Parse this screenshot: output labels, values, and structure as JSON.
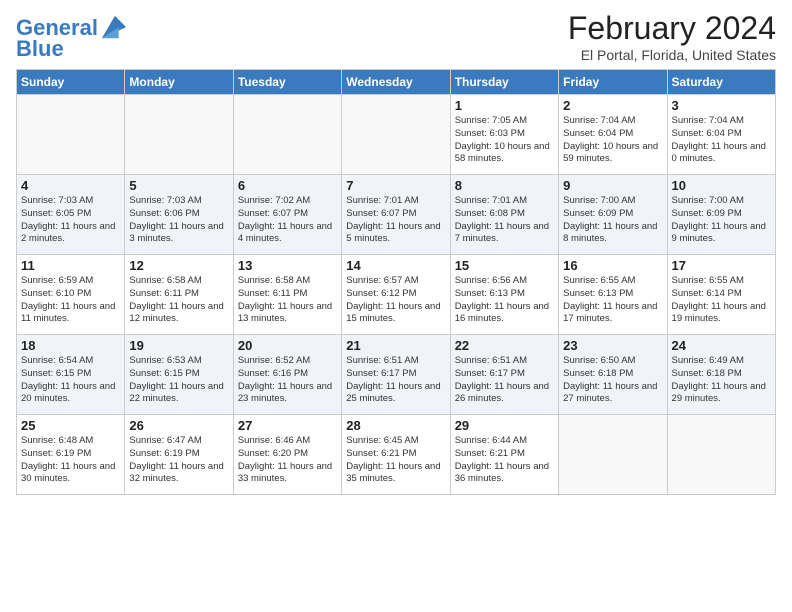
{
  "header": {
    "logo_general": "General",
    "logo_blue": "Blue",
    "title": "February 2024",
    "location": "El Portal, Florida, United States"
  },
  "weekdays": [
    "Sunday",
    "Monday",
    "Tuesday",
    "Wednesday",
    "Thursday",
    "Friday",
    "Saturday"
  ],
  "weeks": [
    [
      {
        "day": "",
        "empty": true
      },
      {
        "day": "",
        "empty": true
      },
      {
        "day": "",
        "empty": true
      },
      {
        "day": "",
        "empty": true
      },
      {
        "day": "1",
        "sunrise": "7:05 AM",
        "sunset": "6:03 PM",
        "daylight": "10 hours and 58 minutes."
      },
      {
        "day": "2",
        "sunrise": "7:04 AM",
        "sunset": "6:04 PM",
        "daylight": "10 hours and 59 minutes."
      },
      {
        "day": "3",
        "sunrise": "7:04 AM",
        "sunset": "6:04 PM",
        "daylight": "11 hours and 0 minutes."
      }
    ],
    [
      {
        "day": "4",
        "sunrise": "7:03 AM",
        "sunset": "6:05 PM",
        "daylight": "11 hours and 2 minutes."
      },
      {
        "day": "5",
        "sunrise": "7:03 AM",
        "sunset": "6:06 PM",
        "daylight": "11 hours and 3 minutes."
      },
      {
        "day": "6",
        "sunrise": "7:02 AM",
        "sunset": "6:07 PM",
        "daylight": "11 hours and 4 minutes."
      },
      {
        "day": "7",
        "sunrise": "7:01 AM",
        "sunset": "6:07 PM",
        "daylight": "11 hours and 5 minutes."
      },
      {
        "day": "8",
        "sunrise": "7:01 AM",
        "sunset": "6:08 PM",
        "daylight": "11 hours and 7 minutes."
      },
      {
        "day": "9",
        "sunrise": "7:00 AM",
        "sunset": "6:09 PM",
        "daylight": "11 hours and 8 minutes."
      },
      {
        "day": "10",
        "sunrise": "7:00 AM",
        "sunset": "6:09 PM",
        "daylight": "11 hours and 9 minutes."
      }
    ],
    [
      {
        "day": "11",
        "sunrise": "6:59 AM",
        "sunset": "6:10 PM",
        "daylight": "11 hours and 11 minutes."
      },
      {
        "day": "12",
        "sunrise": "6:58 AM",
        "sunset": "6:11 PM",
        "daylight": "11 hours and 12 minutes."
      },
      {
        "day": "13",
        "sunrise": "6:58 AM",
        "sunset": "6:11 PM",
        "daylight": "11 hours and 13 minutes."
      },
      {
        "day": "14",
        "sunrise": "6:57 AM",
        "sunset": "6:12 PM",
        "daylight": "11 hours and 15 minutes."
      },
      {
        "day": "15",
        "sunrise": "6:56 AM",
        "sunset": "6:13 PM",
        "daylight": "11 hours and 16 minutes."
      },
      {
        "day": "16",
        "sunrise": "6:55 AM",
        "sunset": "6:13 PM",
        "daylight": "11 hours and 17 minutes."
      },
      {
        "day": "17",
        "sunrise": "6:55 AM",
        "sunset": "6:14 PM",
        "daylight": "11 hours and 19 minutes."
      }
    ],
    [
      {
        "day": "18",
        "sunrise": "6:54 AM",
        "sunset": "6:15 PM",
        "daylight": "11 hours and 20 minutes."
      },
      {
        "day": "19",
        "sunrise": "6:53 AM",
        "sunset": "6:15 PM",
        "daylight": "11 hours and 22 minutes."
      },
      {
        "day": "20",
        "sunrise": "6:52 AM",
        "sunset": "6:16 PM",
        "daylight": "11 hours and 23 minutes."
      },
      {
        "day": "21",
        "sunrise": "6:51 AM",
        "sunset": "6:17 PM",
        "daylight": "11 hours and 25 minutes."
      },
      {
        "day": "22",
        "sunrise": "6:51 AM",
        "sunset": "6:17 PM",
        "daylight": "11 hours and 26 minutes."
      },
      {
        "day": "23",
        "sunrise": "6:50 AM",
        "sunset": "6:18 PM",
        "daylight": "11 hours and 27 minutes."
      },
      {
        "day": "24",
        "sunrise": "6:49 AM",
        "sunset": "6:18 PM",
        "daylight": "11 hours and 29 minutes."
      }
    ],
    [
      {
        "day": "25",
        "sunrise": "6:48 AM",
        "sunset": "6:19 PM",
        "daylight": "11 hours and 30 minutes."
      },
      {
        "day": "26",
        "sunrise": "6:47 AM",
        "sunset": "6:19 PM",
        "daylight": "11 hours and 32 minutes."
      },
      {
        "day": "27",
        "sunrise": "6:46 AM",
        "sunset": "6:20 PM",
        "daylight": "11 hours and 33 minutes."
      },
      {
        "day": "28",
        "sunrise": "6:45 AM",
        "sunset": "6:21 PM",
        "daylight": "11 hours and 35 minutes."
      },
      {
        "day": "29",
        "sunrise": "6:44 AM",
        "sunset": "6:21 PM",
        "daylight": "11 hours and 36 minutes."
      },
      {
        "day": "",
        "empty": true
      },
      {
        "day": "",
        "empty": true
      }
    ]
  ],
  "labels": {
    "sunrise_prefix": "Sunrise: ",
    "sunset_prefix": "Sunset: ",
    "daylight_prefix": "Daylight: "
  }
}
